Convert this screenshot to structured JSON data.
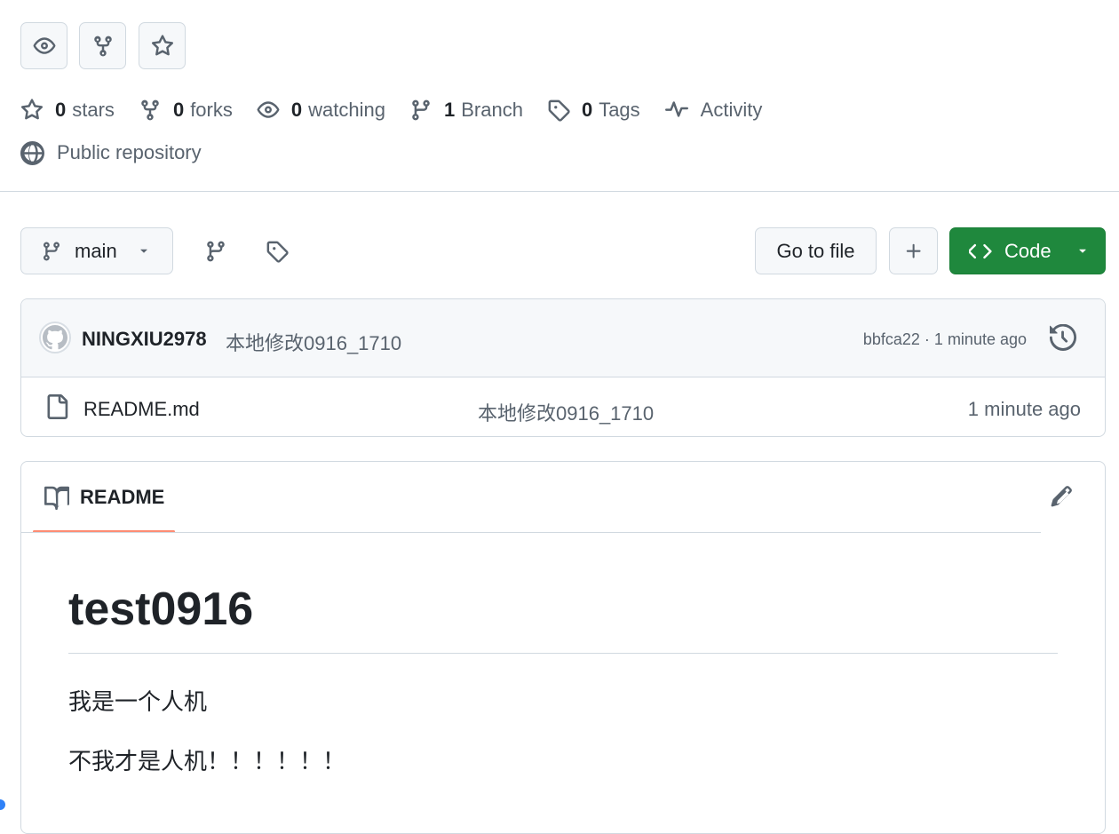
{
  "actions": {
    "watch_icon": "eye-icon",
    "fork_icon": "repo-forked-icon",
    "star_icon": "star-icon"
  },
  "stats": [
    {
      "num": "0",
      "label": "stars",
      "icon": "star-icon"
    },
    {
      "num": "0",
      "label": "forks",
      "icon": "repo-forked-icon"
    },
    {
      "num": "0",
      "label": "watching",
      "icon": "eye-icon"
    },
    {
      "num": "1",
      "label": "Branch",
      "icon": "git-branch-icon"
    },
    {
      "num": "0",
      "label": "Tags",
      "icon": "tag-icon"
    },
    {
      "num": "",
      "label": "Activity",
      "icon": "pulse-icon"
    }
  ],
  "visibility": "Public repository",
  "toolbar": {
    "branch": "main",
    "go_to_file": "Go to file",
    "add": "+",
    "code": "Code"
  },
  "commit": {
    "author": "NINGXIU2978",
    "message": "本地修改0916_1710",
    "meta": "bbfca22 · 1 minute ago"
  },
  "files": [
    {
      "name": "README.md",
      "commit": "本地修改0916_1710",
      "time": "1 minute ago"
    }
  ],
  "readme": {
    "tab_label": "README",
    "title": "test0916",
    "paragraphs": [
      "我是一个人机",
      "不我才是人机！！！！！！"
    ]
  },
  "colors": {
    "accent_green": "#1f883d",
    "tab_underline": "#fd8c73",
    "border": "#d1d9e0",
    "muted_text": "#59636e"
  }
}
